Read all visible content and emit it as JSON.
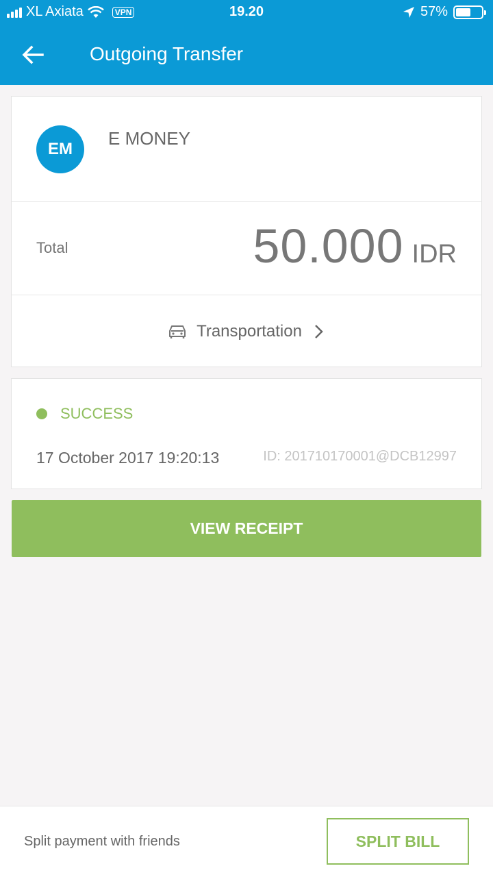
{
  "status_bar": {
    "carrier": "XL Axiata",
    "vpn": "VPN",
    "time": "19.20",
    "battery": "57%",
    "battery_level": 0.57
  },
  "header": {
    "title": "Outgoing Transfer",
    "back_icon": "arrow-left-icon"
  },
  "recipient": {
    "initials": "EM",
    "name": "E MONEY"
  },
  "total": {
    "label": "Total",
    "amount": "50.000",
    "currency": "IDR"
  },
  "category": {
    "label": "Transportation",
    "icon": "car-icon"
  },
  "transaction": {
    "status": "SUCCESS",
    "date": "17 October 2017 19:20:13",
    "id": "ID: 201710170001@DCB12997"
  },
  "actions": {
    "view_receipt": "VIEW RECEIPT"
  },
  "bottom_bar": {
    "text": "Split payment with friends",
    "button": "SPLIT BILL"
  },
  "colors": {
    "primary": "#0b9ad6",
    "success": "#8fbe5d",
    "background": "#f6f4f5"
  }
}
